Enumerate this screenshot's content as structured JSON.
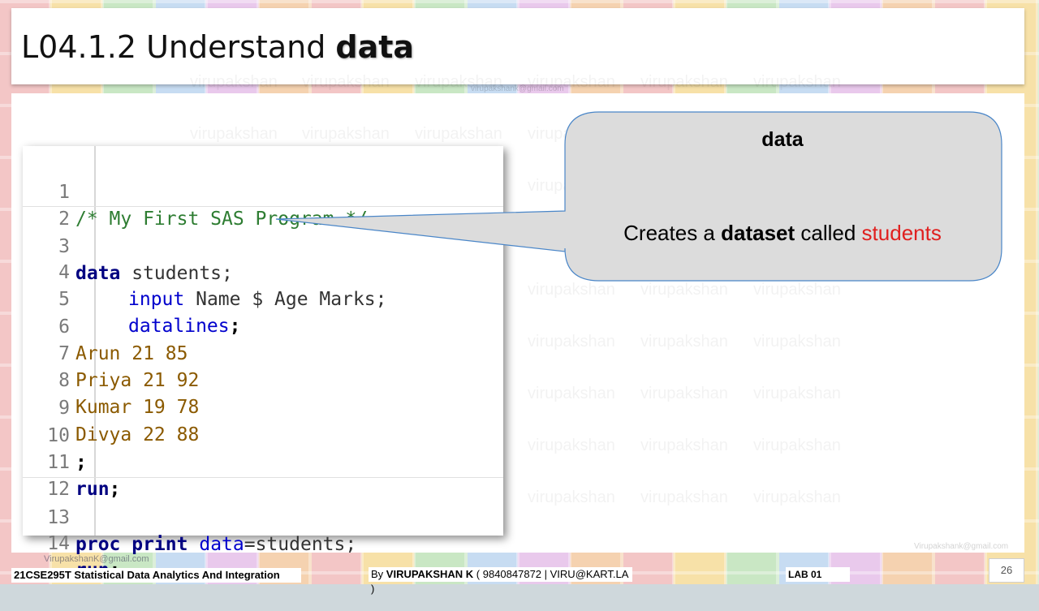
{
  "title": {
    "prefix": "L04.1.2 Understand ",
    "bold": "data"
  },
  "watermark": {
    "text": "virupakshan",
    "email": "VirupakshanK@gmail.com",
    "email_top": "virupakshank@gmail.com",
    "email_right": "Virupakshank@gmail.com"
  },
  "code": {
    "line_numbers": [
      "1",
      "2",
      "3",
      "4",
      "5",
      "6",
      "7",
      "8",
      "9",
      "10",
      "11",
      "12",
      "13",
      "14"
    ],
    "line1_comment": "/* My First SAS Program */",
    "line3_kw": "data",
    "line3_rest": " students;",
    "line4_kw": "input",
    "line4_rest": " Name $ Age Marks;",
    "line5_kw": "datalines",
    "line5_rest": ";",
    "line6": "Arun 21 85",
    "line7": "Priya 21 92",
    "line8": "Kumar 19 78",
    "line9": "Divya 22 88",
    "line10": ";",
    "line11_kw": "run",
    "line11_rest": ";",
    "line13_kw1": "proc print",
    "line13_kw2": "data",
    "line13_rest": "=students;",
    "line14_kw": "run",
    "line14_rest": ";"
  },
  "callout": {
    "title": "data",
    "text_pre": "Creates a ",
    "text_bold": "dataset",
    "text_mid": " called ",
    "text_red": "students",
    "fill": "#dcdcdc",
    "border": "#4a86c8"
  },
  "footer": {
    "course": "21CSE295T Statistical Data Analytics And Integration",
    "by_prefix": "By ",
    "author": "VIRUPAKSHAN K",
    "contact": " ( 9840847872 | VIRU@KART.LA )",
    "lab": "LAB  01",
    "page": "26"
  }
}
